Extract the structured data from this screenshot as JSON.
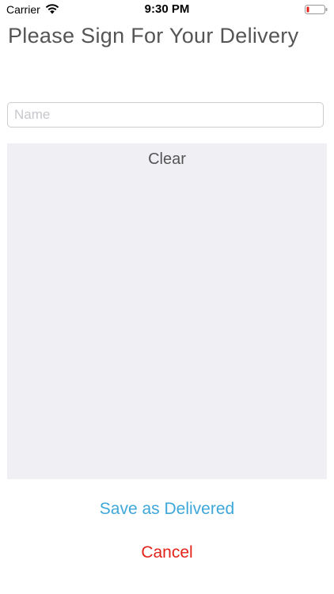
{
  "status_bar": {
    "carrier": "Carrier",
    "time": "9:30 PM",
    "wifi_icon": "wifi-icon",
    "battery_icon": "battery-low-icon",
    "battery_color": "#e2231a"
  },
  "header": {
    "title": "Please Sign For Your Delivery"
  },
  "form": {
    "name_placeholder": "Name",
    "name_value": ""
  },
  "signature_pad": {
    "clear_label": "Clear",
    "background": "#efeff4"
  },
  "actions": {
    "save_label": "Save as Delivered",
    "save_color": "#3ea7d9",
    "cancel_label": "Cancel",
    "cancel_color": "#e2231a"
  }
}
